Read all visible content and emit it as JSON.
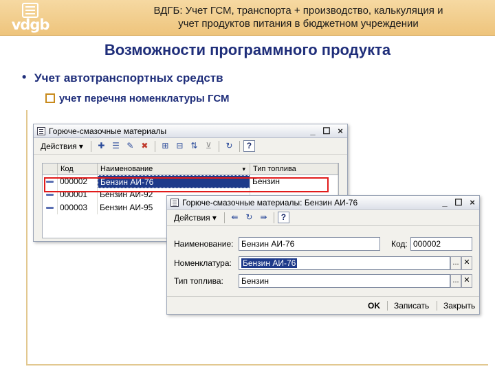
{
  "logo": {
    "text": "vdgb"
  },
  "header": {
    "title_line1": "ВДГБ: Учет ГСМ, транспорта + производство, калькуляция и",
    "title_line2": "учет продуктов питания в бюджетном учреждении"
  },
  "slide": {
    "title": "Возможности программного продукта",
    "bullet": "Учет автотранспортных средств",
    "sub_bullet": "учет перечня номенклатуры ГСМ"
  },
  "list_window": {
    "title": "Горюче-смазочные материалы",
    "menu_label": "Действия",
    "columns": [
      "Код",
      "Наименование",
      "Тип топлива"
    ],
    "rows": [
      {
        "code": "000002",
        "name": "Бензин АИ-76",
        "fuel": "Бензин"
      },
      {
        "code": "000001",
        "name": "Бензин АИ-92",
        "fuel": ""
      },
      {
        "code": "000003",
        "name": "Бензин АИ-95",
        "fuel": ""
      }
    ]
  },
  "form_window": {
    "title": "Горюче-смазочные материалы: Бензин АИ-76",
    "menu_label": "Действия",
    "name_label": "Наименование:",
    "name_value": "Бензин АИ-76",
    "code_label": "Код:",
    "code_value": "000002",
    "nomenclature_label": "Номенклатура:",
    "nomenclature_value": "Бензин АИ-76",
    "fuel_label": "Тип топлива:",
    "fuel_value": "Бензин",
    "ok_label": "OK",
    "save_label": "Записать",
    "close_label": "Закрыть"
  },
  "window_controls": {
    "minimize": "_",
    "maximize": "☐",
    "close": "×"
  },
  "colors": {
    "highlight": "#e11b1b",
    "title_text": "#1f2e7a",
    "selection": "#1e3a8a"
  }
}
